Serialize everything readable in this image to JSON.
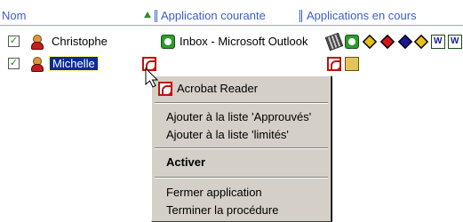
{
  "header": {
    "col_name": "Nom",
    "col_current_app": "Application courante",
    "col_running_apps": "Applications en cours"
  },
  "rows": [
    {
      "checked": true,
      "name": "Christophe",
      "current_app": "Inbox - Microsoft Outlook",
      "selected": false
    },
    {
      "checked": true,
      "name": "Michelle",
      "current_app": "Acrobat Reader",
      "selected": true
    }
  ],
  "context_menu": {
    "title_item": "Acrobat Reader",
    "approve_item": "Ajouter à la liste 'Approuvés'",
    "limit_item": "Ajouter à la liste 'limités'",
    "activate_item": "Activer",
    "close_item": "Fermer application",
    "end_item": "Terminer la procédure"
  }
}
